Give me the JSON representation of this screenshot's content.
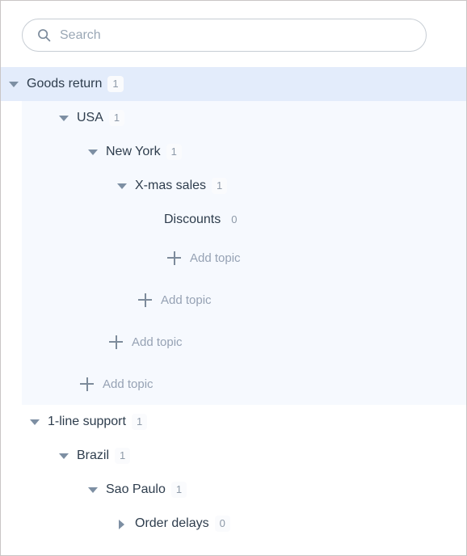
{
  "search": {
    "placeholder": "Search",
    "value": "",
    "icon": "search-icon"
  },
  "colors": {
    "selected_row_bg": "#e3ecfb",
    "group_tint_bg": "#f6f9fe",
    "label_text": "#2e3d4d",
    "muted_text": "#96a2b4",
    "badge_text": "#8d99a8",
    "caret": "#7d8fa3",
    "border": "#c9c6c6"
  },
  "tree": {
    "groups": [
      {
        "id": "goods-return",
        "tinted": true,
        "rows": [
          {
            "type": "node",
            "label": "Goods return",
            "badge": "1",
            "caret": "expanded",
            "indent": 0,
            "selected": true,
            "badge_filled": true
          },
          {
            "type": "node",
            "label": "USA",
            "badge": "1",
            "caret": "expanded",
            "indent": 1,
            "selected": false,
            "badge_filled": true
          },
          {
            "type": "node",
            "label": "New York",
            "badge": "1",
            "caret": "expanded",
            "indent": 2,
            "selected": false,
            "badge_filled": true
          },
          {
            "type": "node",
            "label": "X-mas sales",
            "badge": "1",
            "caret": "expanded",
            "indent": 3,
            "selected": false,
            "badge_filled": true
          },
          {
            "type": "node",
            "label": "Discounts",
            "badge": "0",
            "caret": "none",
            "indent": 4,
            "selected": false,
            "badge_filled": false
          },
          {
            "type": "add",
            "label": "Add topic",
            "icon": "plus-icon",
            "indent": 4
          },
          {
            "type": "add",
            "label": "Add topic",
            "icon": "plus-icon",
            "indent": 3
          },
          {
            "type": "add",
            "label": "Add topic",
            "icon": "plus-icon",
            "indent": 2
          },
          {
            "type": "add",
            "label": "Add topic",
            "icon": "plus-icon",
            "indent": 1
          }
        ]
      },
      {
        "id": "1-line-support",
        "tinted": false,
        "rows": [
          {
            "type": "node",
            "label": "1-line support",
            "badge": "1",
            "caret": "expanded",
            "indent": 0,
            "selected": false,
            "badge_filled": true
          },
          {
            "type": "node",
            "label": "Brazil",
            "badge": "1",
            "caret": "expanded",
            "indent": 1,
            "selected": false,
            "badge_filled": true
          },
          {
            "type": "node",
            "label": "Sao Paulo",
            "badge": "1",
            "caret": "expanded",
            "indent": 2,
            "selected": false,
            "badge_filled": true
          },
          {
            "type": "node",
            "label": "Order delays",
            "badge": "0",
            "caret": "collapsed",
            "indent": 3,
            "selected": false,
            "badge_filled": true
          }
        ]
      }
    ]
  }
}
